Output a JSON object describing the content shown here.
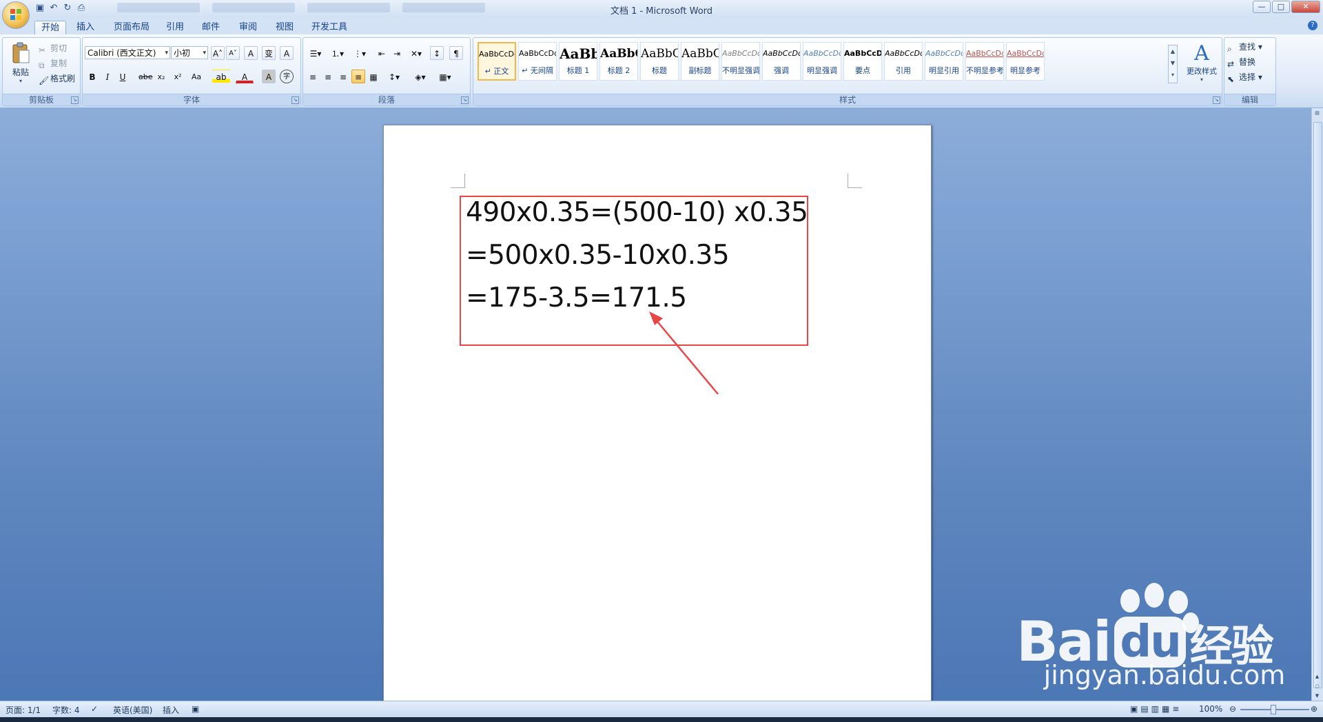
{
  "window": {
    "title": "文档 1 - Microsoft Word",
    "controls": {
      "minimize": "—",
      "maximize": "□",
      "close": "✕"
    }
  },
  "quick_access": [
    "save",
    "undo",
    "redo",
    "print-preview"
  ],
  "tabs": [
    {
      "label": "开始",
      "active": true
    },
    {
      "label": "插入"
    },
    {
      "label": "页面布局"
    },
    {
      "label": "引用"
    },
    {
      "label": "邮件"
    },
    {
      "label": "审阅"
    },
    {
      "label": "视图"
    },
    {
      "label": "开发工具"
    }
  ],
  "clipboard": {
    "paste": "粘贴",
    "cut": "剪切",
    "copy": "复制",
    "format_painter": "格式刷",
    "group_label": "剪贴板"
  },
  "font": {
    "name": "Calibri (西文正文)",
    "size": "小初",
    "group_label": "字体",
    "bold": "B",
    "italic": "I",
    "underline": "U",
    "strike": "abe",
    "subscript": "x₂",
    "superscript": "x²",
    "change_case": "Aa",
    "grow": "A",
    "shrink": "A",
    "clear": "A",
    "phonetic": "变",
    "border_char": "A",
    "highlight": "ab",
    "font_color": "A",
    "char_shading": "A",
    "enclose": "字"
  },
  "paragraph": {
    "group_label": "段落"
  },
  "styles": {
    "group_label": "样式",
    "items": [
      {
        "sample": "AaBbCcDd",
        "name": "↵ 正文",
        "active": true
      },
      {
        "sample": "AaBbCcDd",
        "name": "↵ 无间隔"
      },
      {
        "sample": "AaBb",
        "name": "标题 1",
        "big": true
      },
      {
        "sample": "AaBbC",
        "name": "标题 2",
        "med": true
      },
      {
        "sample": "AaBbC",
        "name": "标题",
        "med": true
      },
      {
        "sample": "AaBbC",
        "name": "副标题",
        "med": true
      },
      {
        "sample": "AaBbCcDd",
        "name": "不明显强调"
      },
      {
        "sample": "AaBbCcDd",
        "name": "强调"
      },
      {
        "sample": "AaBbCcDd",
        "name": "明显强调"
      },
      {
        "sample": "AaBbCcDd",
        "name": "要点"
      },
      {
        "sample": "AaBbCcDd",
        "name": "引用"
      },
      {
        "sample": "AaBbCcDd",
        "name": "明显引用"
      },
      {
        "sample": "AaBbCcDd",
        "name": "不明显参考"
      },
      {
        "sample": "AaBbCcDd",
        "name": "明显参考"
      }
    ],
    "change_styles": "更改样式"
  },
  "editing": {
    "group_label": "编辑",
    "find": "查找",
    "replace": "替换",
    "select": "选择"
  },
  "document": {
    "lines": [
      "490x0.35=(500-10) x0.35",
      "=500x0.35-10x0.35",
      "=175-3.5=171.5"
    ]
  },
  "statusbar": {
    "page": "页面: 1/1",
    "words": "字数: 4",
    "language": "英语(美国)",
    "mode": "插入",
    "zoom": "100%"
  },
  "watermark": {
    "brand": "Bai",
    "brand_cn": "经验",
    "url": "jingyan.baidu.com"
  }
}
